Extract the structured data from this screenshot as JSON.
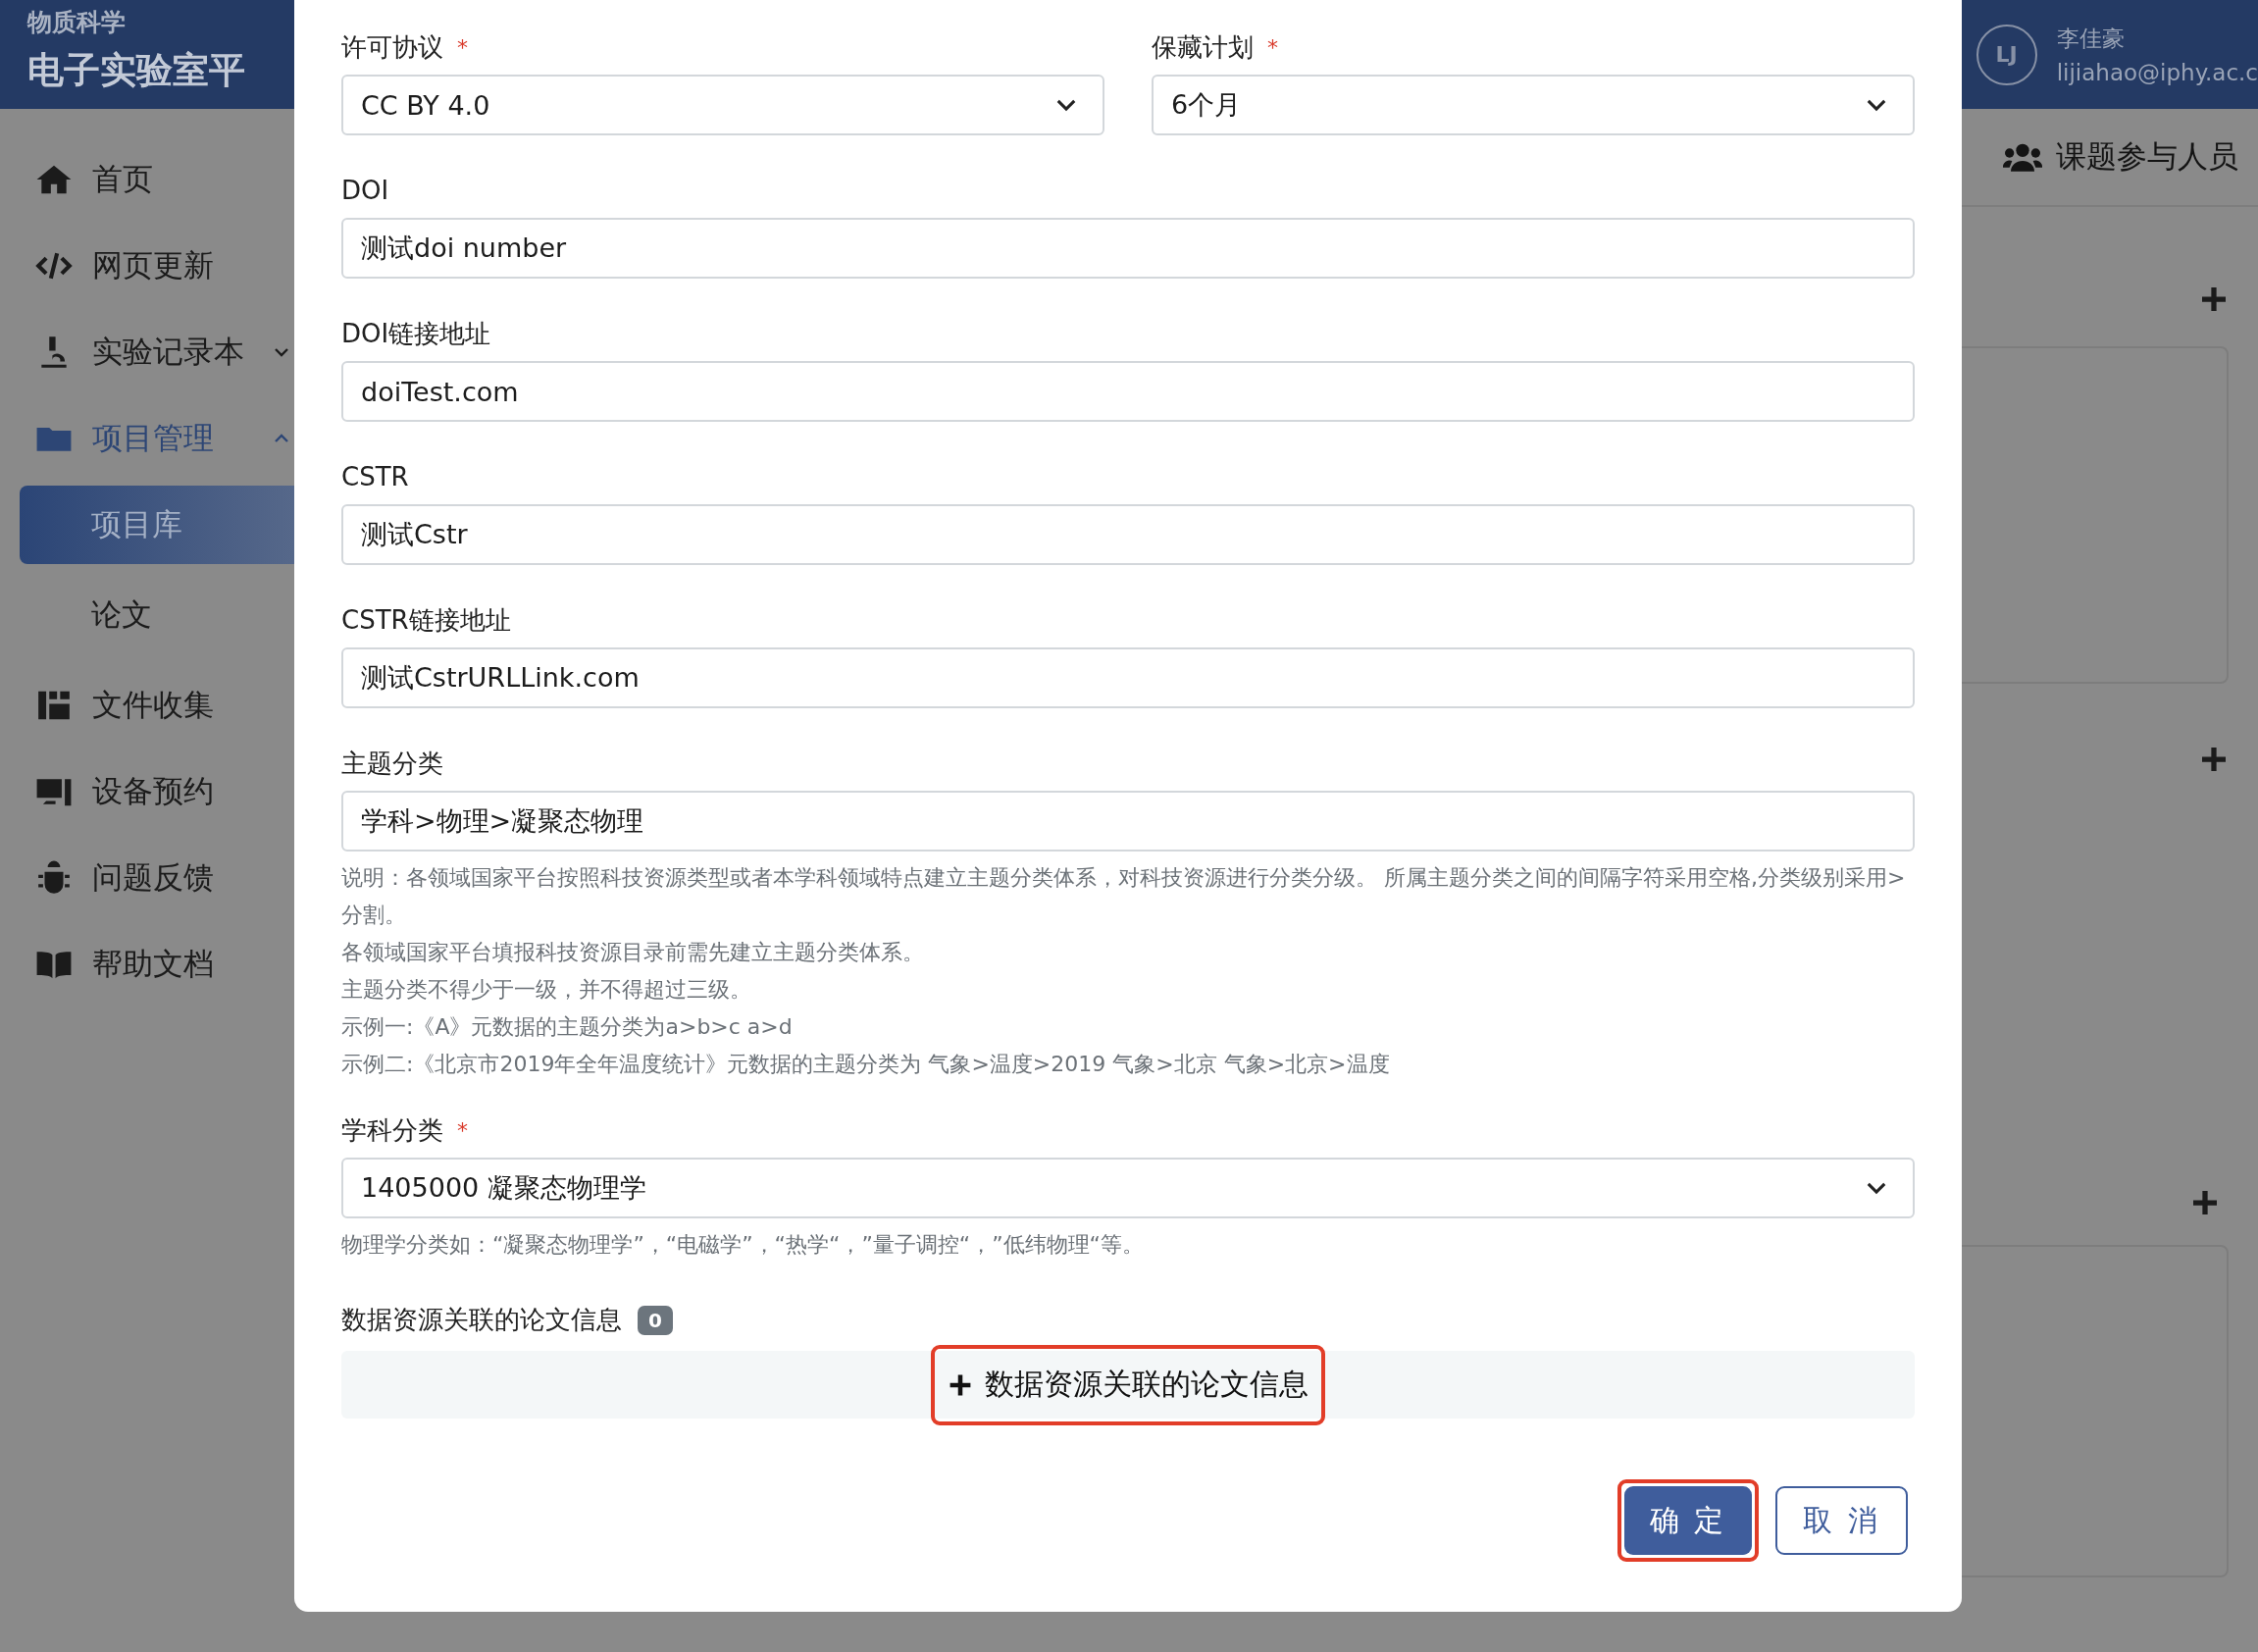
{
  "header": {
    "org": "物质科学",
    "platform": "电子实验室平",
    "user": {
      "initials": "LJ",
      "name": "李佳豪",
      "email": "lijiahao@iphy.ac.c"
    }
  },
  "sidebar": {
    "items": [
      {
        "label": "首页",
        "selected": false
      },
      {
        "label": "网页更新",
        "selected": false
      },
      {
        "label": "实验记录本",
        "selected": false,
        "expanded": false
      },
      {
        "label": "项目管理",
        "selected": false,
        "expanded": true,
        "children": [
          {
            "label": "项目库",
            "selected": true
          },
          {
            "label": "论文",
            "selected": false
          }
        ]
      },
      {
        "label": "文件收集",
        "selected": false
      },
      {
        "label": "设备预约",
        "selected": false
      },
      {
        "label": "问题反馈",
        "selected": false
      },
      {
        "label": "帮助文档",
        "selected": false
      }
    ]
  },
  "main": {
    "tab": {
      "label": "课题参与人员"
    }
  },
  "dialog": {
    "rows": [
      [
        {
          "label": "许可协议",
          "required_mark": "*",
          "kind": "select",
          "value": "CC BY 4.0"
        },
        {
          "label": "保藏计划",
          "required_mark": "*",
          "kind": "select",
          "value": "6个月"
        }
      ],
      [
        {
          "label": "DOI",
          "kind": "input",
          "value": "测试doi number"
        }
      ],
      [
        {
          "label": "DOI链接地址",
          "kind": "input",
          "value": "doiTest.com"
        }
      ],
      [
        {
          "label": "CSTR",
          "kind": "input",
          "value": "测试Cstr"
        }
      ],
      [
        {
          "label": "CSTR链接地址",
          "kind": "input",
          "value": "测试CstrURLLink.com"
        }
      ],
      [
        {
          "label": "主题分类",
          "kind": "input",
          "value": "学科>物理>凝聚态物理",
          "help": [
            "说明：各领域国家平台按照科技资源类型或者本学科领域特点建立主题分类体系，对科技资源进行分类分级。 所属主题分类之间的间隔字符采用空格,分类级别采用>分割。",
            "各领域国家平台填报科技资源目录前需先建立主题分类体系。",
            "主题分类不得少于一级，并不得超过三级。",
            "示例一:《A》元数据的主题分类为a>b>c a>d",
            "示例二:《北京市2019年全年温度统计》元数据的主题分类为 气象>温度>2019 气象>北京 气象>北京>温度"
          ]
        }
      ],
      [
        {
          "label": "学科分类",
          "required_mark": "*",
          "kind": "select",
          "value": "1405000 凝聚态物理学",
          "help": [
            "物理学分类如：“凝聚态物理学”，“电磁学”，“热学“，”量子调控“，”低纬物理“等。"
          ]
        }
      ]
    ],
    "papers": {
      "label": "数据资源关联的论文信息",
      "count": "0",
      "add_button": {
        "label": "数据资源关联的论文信息",
        "highlighted": true
      }
    },
    "buttons": [
      {
        "label": "确 定",
        "kind": "primary",
        "highlighted": true
      },
      {
        "label": "取 消",
        "kind": "secondary",
        "highlighted": false
      }
    ]
  }
}
